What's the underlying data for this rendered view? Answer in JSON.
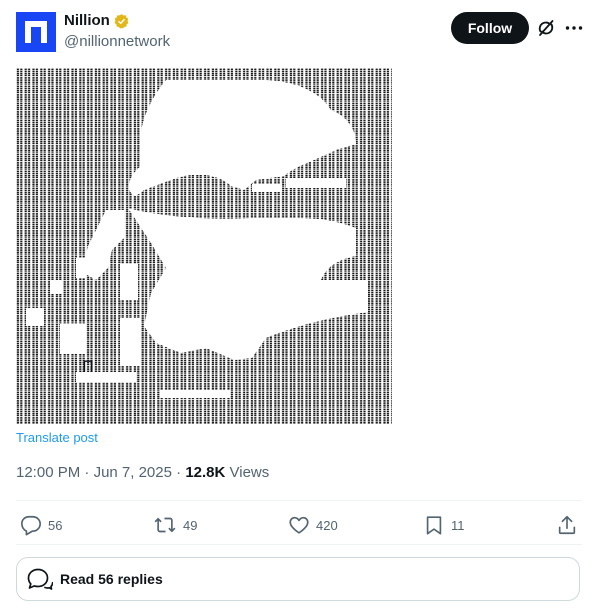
{
  "author": {
    "display_name": "Nillion",
    "handle": "@nillionnetwork",
    "verified": true,
    "verified_badge_color": "#e2b719",
    "avatar_color": "#1846f5"
  },
  "header": {
    "follow_label": "Follow",
    "grok_icon": "grok-icon",
    "more_icon": "more-icon"
  },
  "media": {
    "description": "ASCII art in braille block characters",
    "inline_char": "Π"
  },
  "translate_label": "Translate post",
  "meta": {
    "time": "12:00 PM",
    "separator": "·",
    "date": "Jun 7, 2025",
    "views_count": "12.8K",
    "views_label": "Views"
  },
  "actions": {
    "replies": "56",
    "reposts": "49",
    "likes": "420",
    "bookmarks": "11"
  },
  "read_replies_label": "Read 56 replies",
  "colors": {
    "text_primary": "#0f1419",
    "text_secondary": "#536471",
    "link": "#1d9bf0",
    "border": "#cfd9de"
  }
}
